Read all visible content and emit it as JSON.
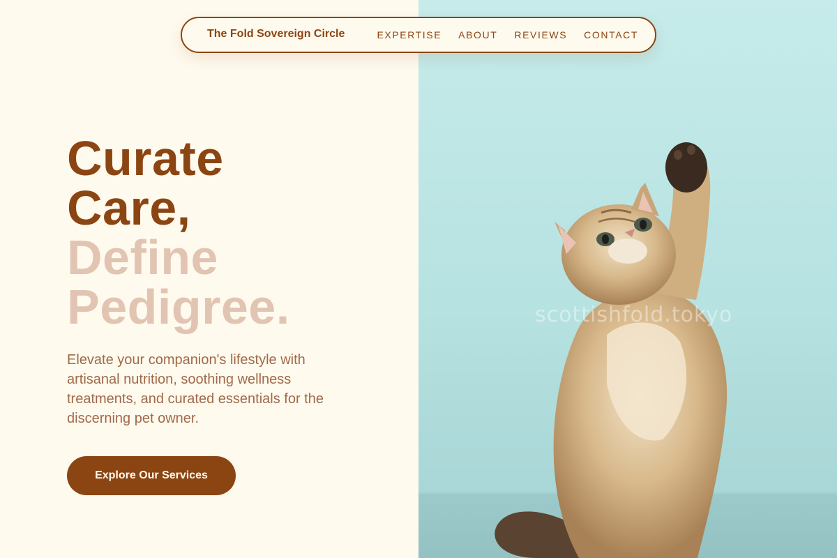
{
  "nav": {
    "brand": "The Fold Sovereign Circle",
    "links": [
      "EXPERTISE",
      "ABOUT",
      "REVIEWS",
      "CONTACT"
    ]
  },
  "hero": {
    "headline_dark": [
      "Curate",
      "Care,"
    ],
    "headline_light": [
      "Define",
      "Pedigree."
    ],
    "lead": "Elevate your companion's lifestyle with artisanal nutrition, soothing wellness treatments, and curated essentials for the discerning pet owner.",
    "cta_label": "Explore Our Services",
    "image_watermark": "scottishfold.tokyo"
  },
  "colors": {
    "brand_brown": "#8b4513",
    "headline_light": "#e2c4b3",
    "lead_text": "#a0694a",
    "page_background": "#fffaee",
    "image_background": "#b9e4e3"
  }
}
